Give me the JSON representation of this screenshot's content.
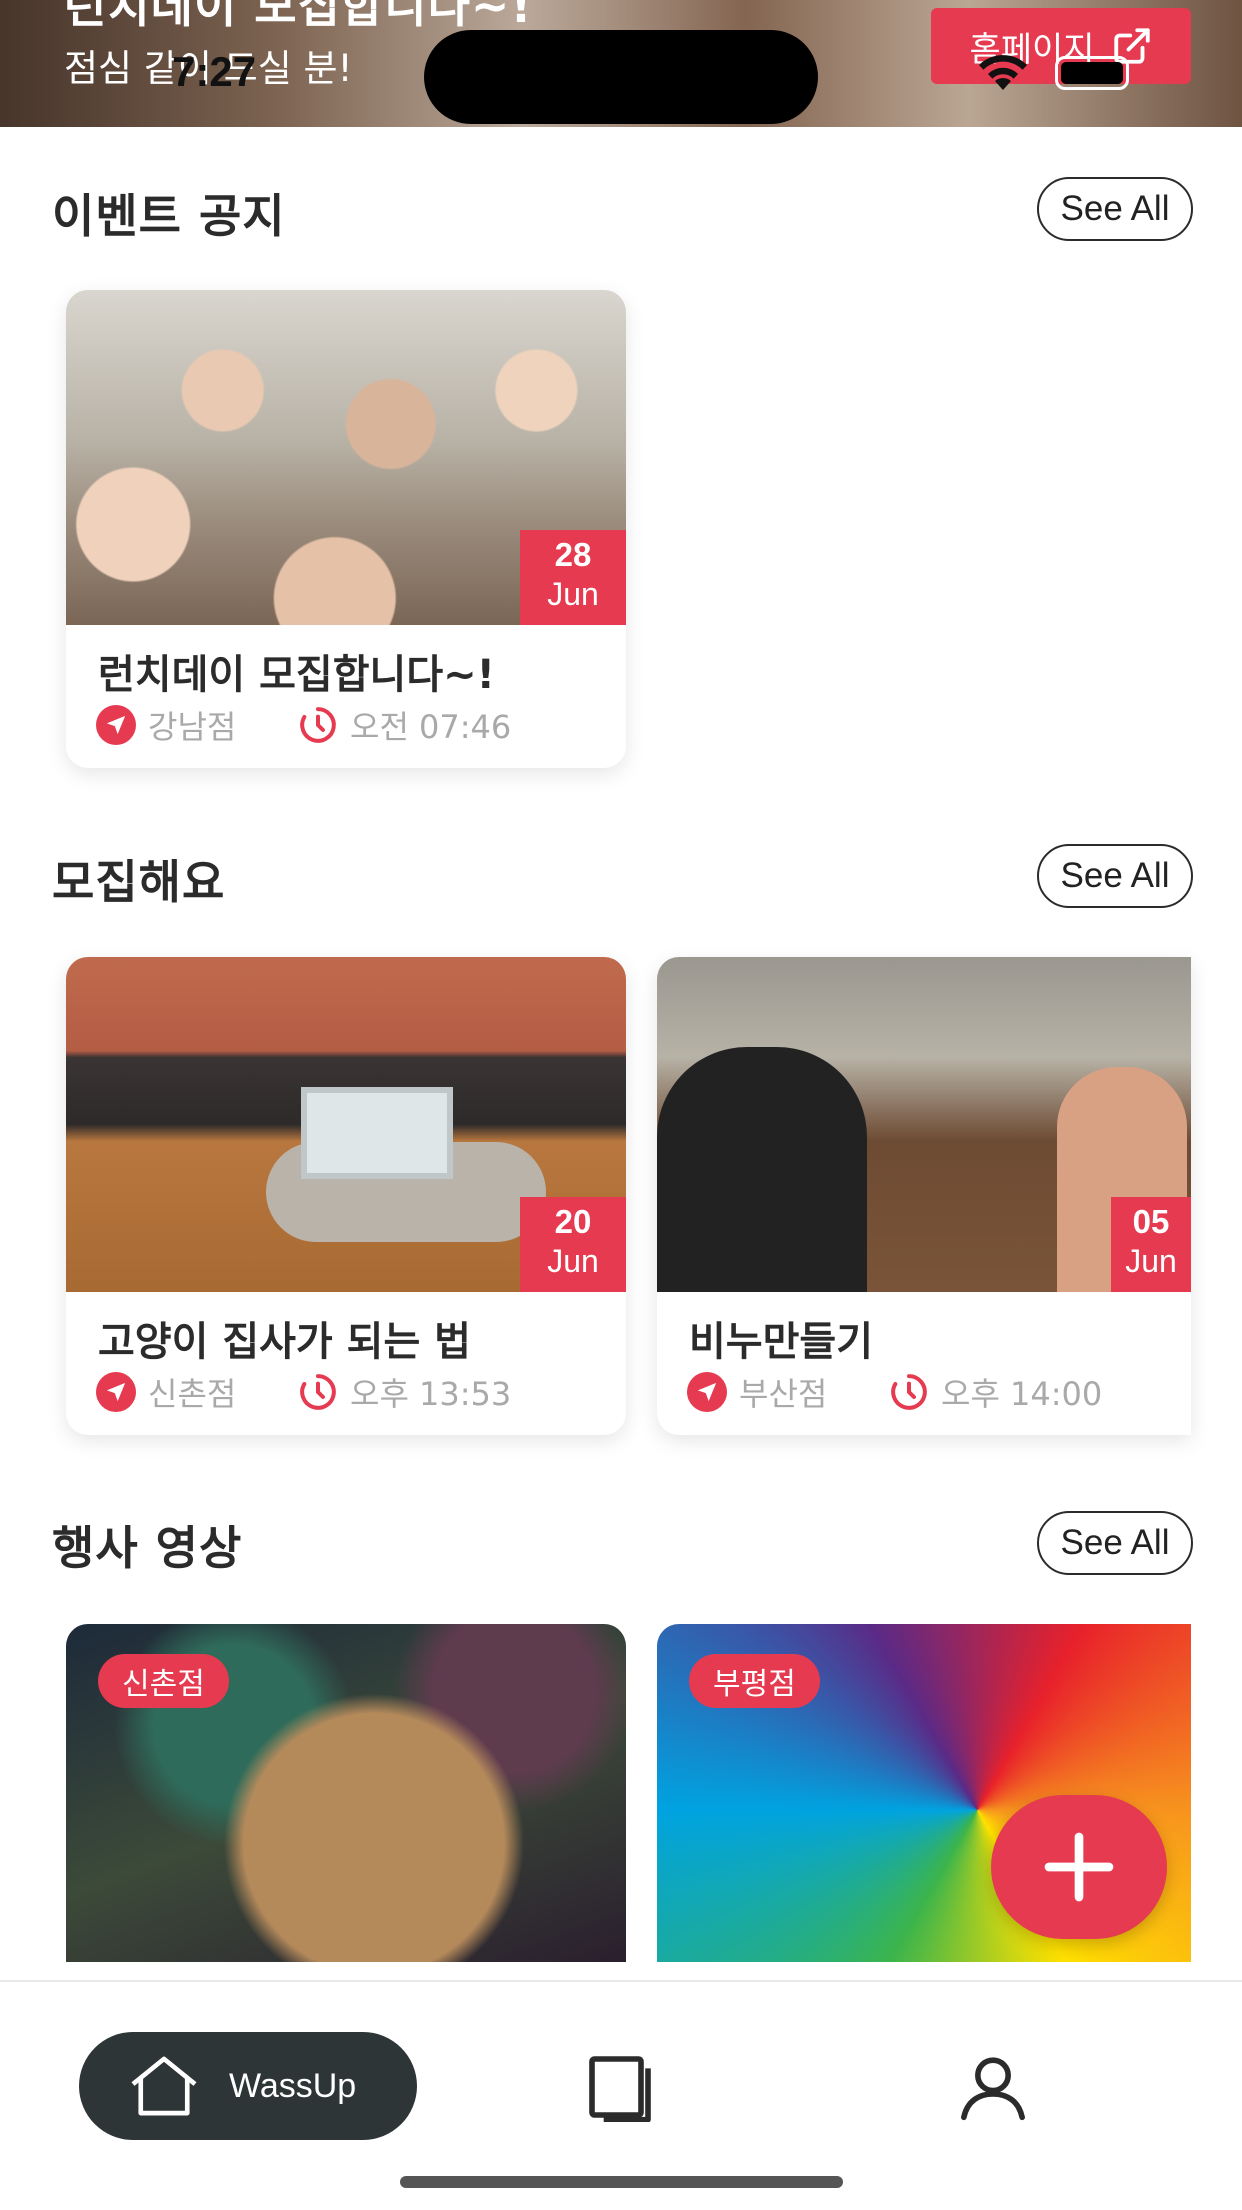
{
  "status_bar": {
    "time": "7:27"
  },
  "hero": {
    "title": "런치데이 모집합니다~!",
    "subtitle": "점심 같이 드실 분!",
    "homepage_button": "홈페이지"
  },
  "sections": {
    "events": {
      "title": "이벤트 공지",
      "see_all": "See All"
    },
    "recruit": {
      "title": "모집해요",
      "see_all": "See All"
    },
    "videos": {
      "title": "행사 영상",
      "see_all": "See All"
    }
  },
  "event_cards": [
    {
      "title": "런치데이 모집합니다~!",
      "day": "28",
      "month": "Jun",
      "location": "강남점",
      "time": "오전 07:46"
    }
  ],
  "recruit_cards": [
    {
      "title": "고양이 집사가 되는 법",
      "day": "20",
      "month": "Jun",
      "location": "신촌점",
      "time": "오후 13:53"
    },
    {
      "title": "비누만들기",
      "day": "05",
      "month": "Jun",
      "location": "부산점",
      "time": "오후 14:00"
    }
  ],
  "video_cards": [
    {
      "location": "신촌점"
    },
    {
      "location": "부평점"
    }
  ],
  "nav": {
    "home_label": "WassUp"
  },
  "colors": {
    "accent": "#e63a50",
    "nav_active_bg": "#2e3536",
    "text": "#2b2b2b",
    "meta": "#a9a9a9"
  }
}
